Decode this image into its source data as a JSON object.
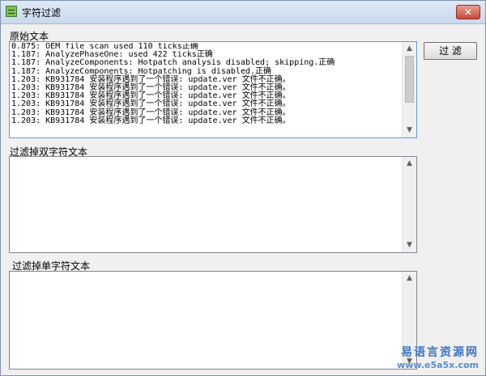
{
  "window": {
    "title": "字符过滤",
    "close_label": "✕"
  },
  "labels": {
    "original": "原始文本",
    "filter_double": "过滤掉双字符文本",
    "filter_single": "过滤掉单字符文本"
  },
  "button": {
    "filter_label": "过 滤"
  },
  "original_text": {
    "lines": [
      "0.875: OEM file scan used 110 ticks正确",
      "1.187: AnalyzePhaseOne: used 422 ticks正确",
      "1.187: AnalyzeComponents: Hotpatch analysis disabled; skipping.正确",
      "1.187: AnalyzeComponents: Hotpatching is disabled.正确",
      "1.203: KB931784 安装程序遇到了一个错误: update.ver 文件不正确。",
      "1.203: KB931784 安装程序遇到了一个错误: update.ver 文件不正确。",
      "1.203: KB931784 安装程序遇到了一个错误: update.ver 文件不正确。",
      "1.203: KB931784 安装程序遇到了一个错误: update.ver 文件不正确。",
      "1.203: KB931784 安装程序遇到了一个错误: update.ver 文件不正确。",
      "1.203: KB931784 安装程序遇到了一个错误: update.ver 文件不正确。"
    ]
  },
  "watermark": {
    "line1": "易语言资源网",
    "line2": "www.e5a5x.com"
  },
  "icons": {
    "scroll_up": "▲",
    "scroll_down": "▼"
  }
}
